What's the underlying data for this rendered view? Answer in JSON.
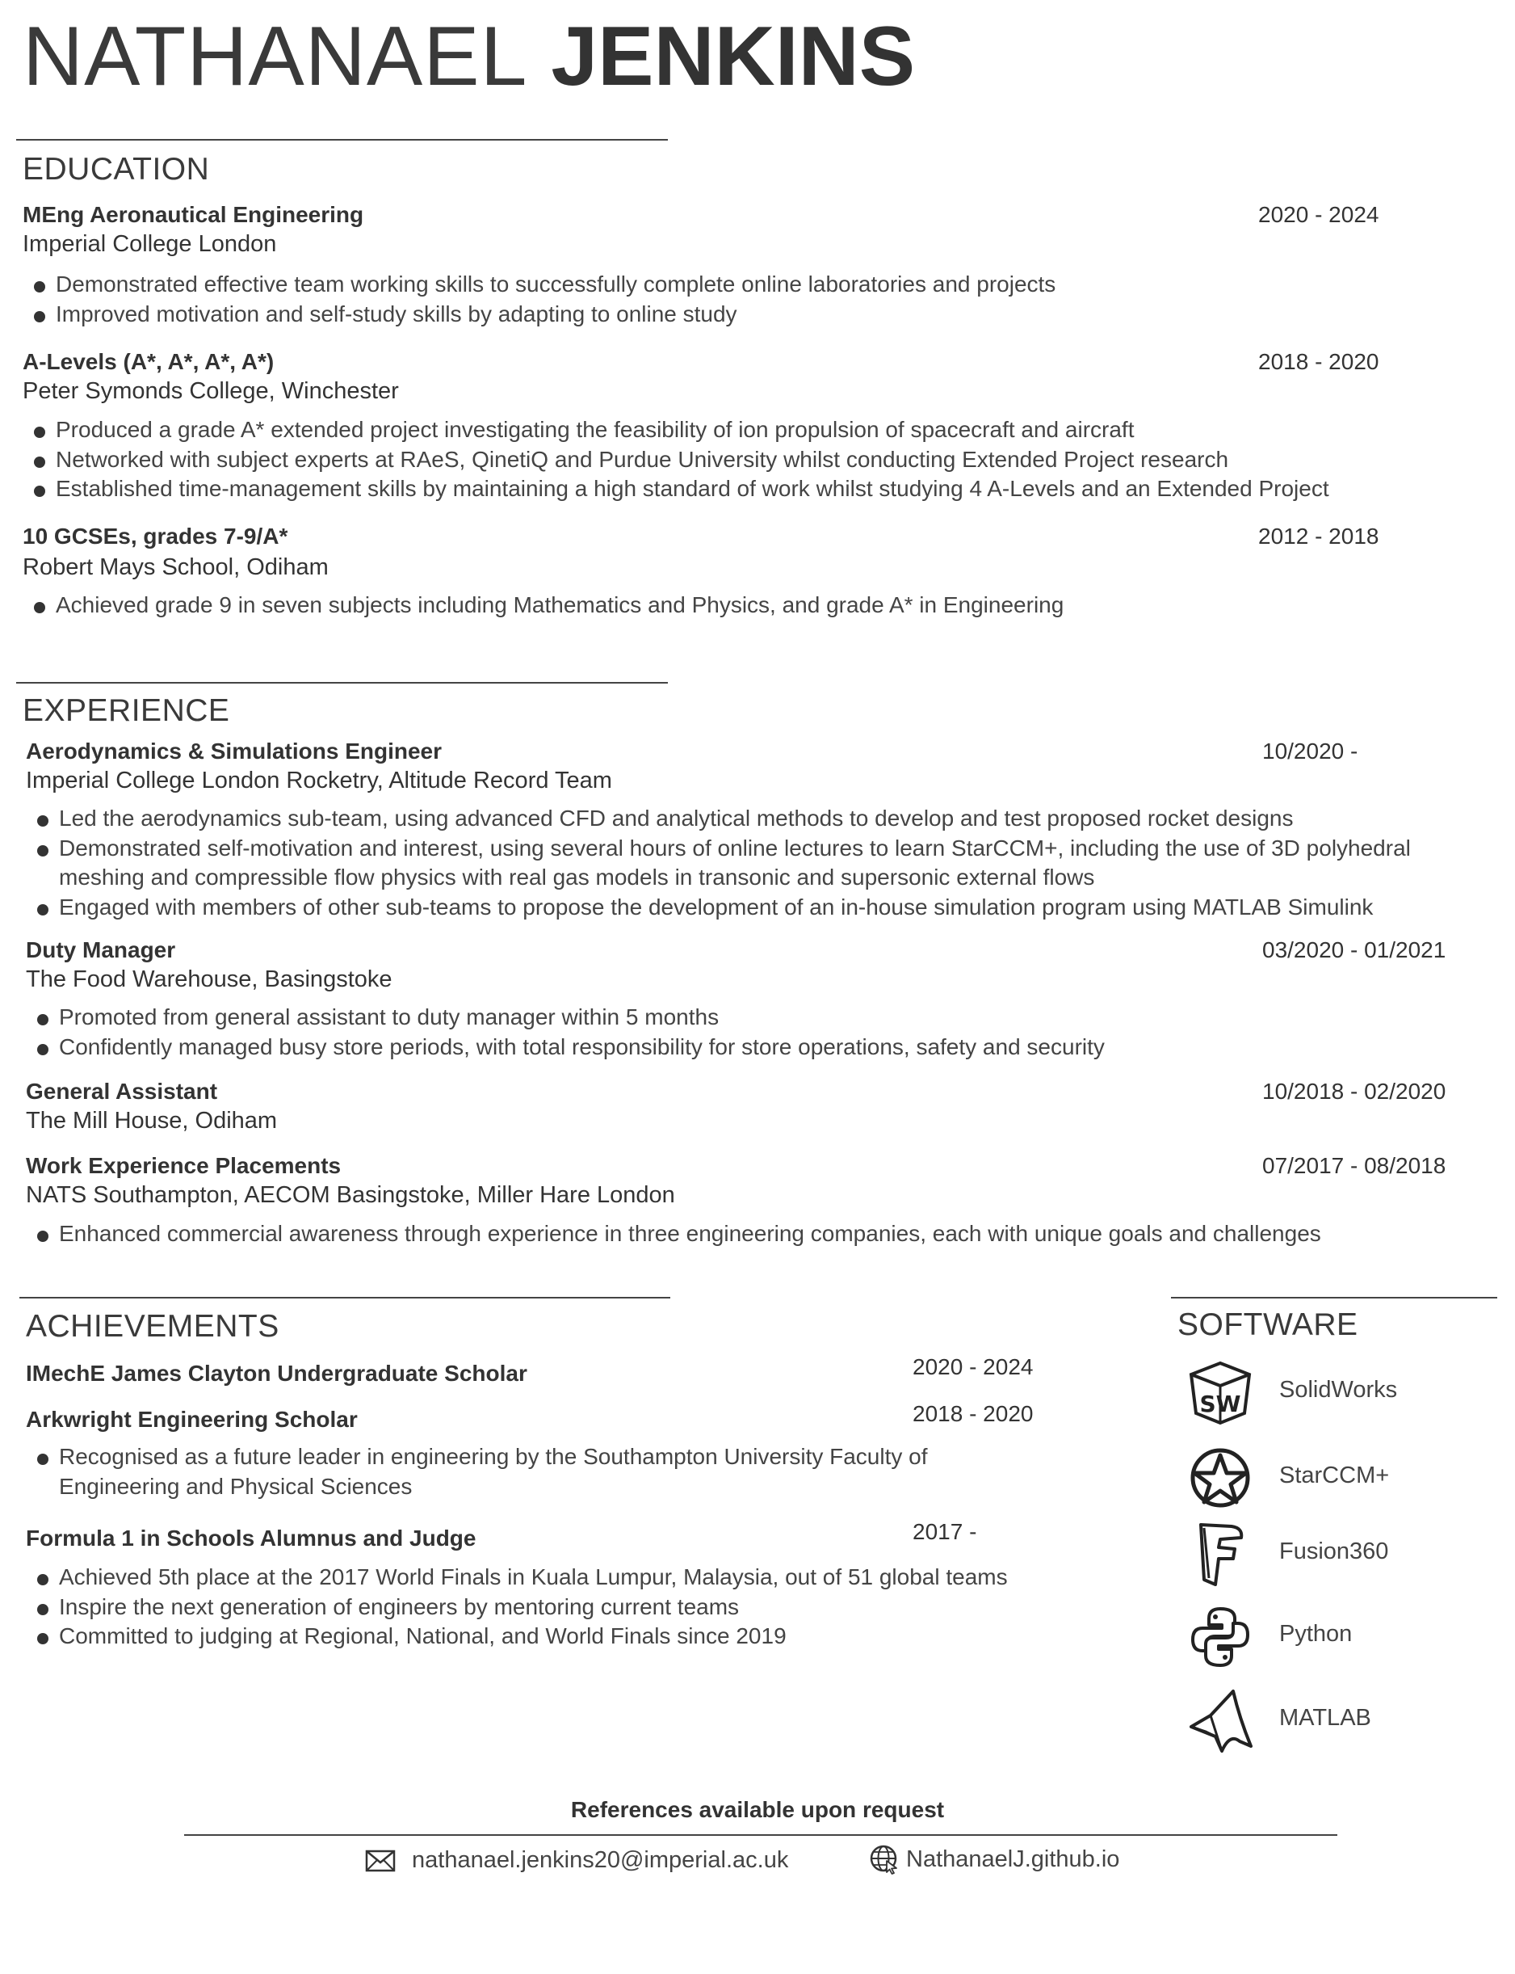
{
  "header": {
    "first_name": "NATHANAEL",
    "last_name": "JENKINS"
  },
  "education": {
    "heading": "EDUCATION",
    "entries": [
      {
        "title": "MEng Aeronautical Engineering",
        "org": "Imperial College London",
        "date": "2020 - 2024",
        "bullets": [
          "Demonstrated effective team working skills to successfully complete online laboratories and projects",
          "Improved motivation and self-study skills by adapting to online study"
        ]
      },
      {
        "title": "A-Levels (A*, A*, A*, A*)",
        "org": "Peter Symonds College, Winchester",
        "date": "2018 - 2020",
        "bullets": [
          "Produced a grade A* extended project investigating the feasibility of ion propulsion of spacecraft and aircraft",
          "Networked with subject experts at RAeS, QinetiQ and Purdue University whilst conducting Extended Project research",
          "Established time-management skills by maintaining a high standard of work whilst studying 4 A-Levels and an Extended Project"
        ]
      },
      {
        "title": "10 GCSEs, grades 7-9/A*",
        "org": "Robert Mays School, Odiham",
        "date": "2012 - 2018",
        "bullets": [
          "Achieved grade 9 in seven subjects including Mathematics and Physics, and grade A* in Engineering"
        ]
      }
    ]
  },
  "experience": {
    "heading": "EXPERIENCE",
    "entries": [
      {
        "title": "Aerodynamics & Simulations Engineer",
        "org": "Imperial College London Rocketry, Altitude Record Team",
        "date": "10/2020 -",
        "bullets": [
          "Led the aerodynamics sub-team, using advanced CFD and analytical methods to develop and test proposed rocket designs",
          "Demonstrated self-motivation and interest, using several hours of online lectures to learn StarCCM+, including the use of 3D polyhedral meshing and compressible flow physics with real gas models in transonic and supersonic external flows",
          "Engaged with members of other sub-teams to propose the development of an in-house simulation program using MATLAB Simulink"
        ]
      },
      {
        "title": "Duty Manager",
        "org": "The Food Warehouse, Basingstoke",
        "date": "03/2020 - 01/2021",
        "bullets": [
          "Promoted from general assistant to duty manager within 5 months",
          "Confidently managed busy store periods, with total responsibility for store operations, safety and security"
        ]
      },
      {
        "title": "General Assistant",
        "org": "The Mill House, Odiham",
        "date": "10/2018 - 02/2020",
        "bullets": []
      },
      {
        "title": "Work Experience Placements",
        "org": "NATS Southampton, AECOM Basingstoke, Miller Hare London",
        "date": "07/2017 - 08/2018",
        "bullets": [
          "Enhanced commercial awareness through experience in three engineering companies, each with unique goals and challenges"
        ]
      }
    ]
  },
  "achievements": {
    "heading": "ACHIEVEMENTS",
    "entries": [
      {
        "title": "IMechE James Clayton Undergraduate Scholar",
        "date": "2020 - 2024",
        "bullets": []
      },
      {
        "title": "Arkwright Engineering Scholar",
        "date": "2018 - 2020",
        "bullets": [
          "Recognised as a future leader in engineering by the Southampton University Faculty of Engineering and Physical Sciences"
        ]
      },
      {
        "title": "Formula 1 in Schools Alumnus and Judge",
        "date": "2017 -",
        "bullets": [
          "Achieved 5th place at the 2017 World Finals in Kuala Lumpur, Malaysia, out of 51 global teams",
          "Inspire the next generation of engineers by mentoring current teams",
          "Committed to judging at Regional, National, and World Finals since 2019"
        ]
      }
    ]
  },
  "software": {
    "heading": "SOFTWARE",
    "items": [
      {
        "label": "SolidWorks",
        "icon": "solidworks-icon",
        "icon_text": "SW"
      },
      {
        "label": "StarCCM+",
        "icon": "starccm-icon"
      },
      {
        "label": "Fusion360",
        "icon": "fusion360-icon"
      },
      {
        "label": "Python",
        "icon": "python-icon"
      },
      {
        "label": "MATLAB",
        "icon": "matlab-icon"
      }
    ]
  },
  "footer": {
    "note": "References available upon request",
    "email": "nathanael.jenkins20@imperial.ac.uk",
    "website": "NathanaelJ.github.io"
  }
}
